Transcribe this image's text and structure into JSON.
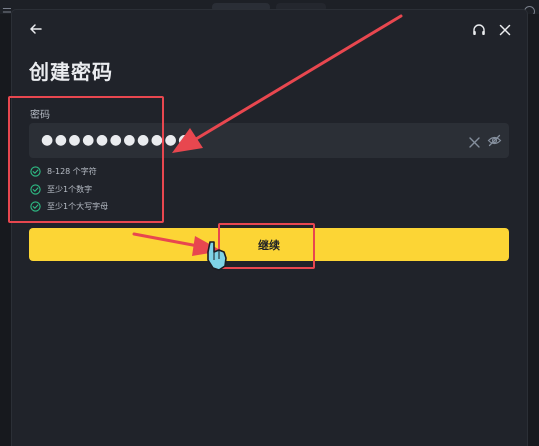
{
  "modal": {
    "title": "创建密码",
    "password_label": "密码",
    "password_value": "●●●●●●●●●●●",
    "rules": [
      {
        "text": "8-128 个字符"
      },
      {
        "text": "至少1个数字"
      },
      {
        "text": "至少1个大写字母"
      }
    ],
    "continue_label": "继续"
  },
  "background": {
    "menu_glyph": "☰"
  },
  "icons": {
    "back": "arrow-left-icon",
    "support": "headset-icon",
    "close": "close-icon",
    "clear": "clear-x-icon",
    "visibility": "eye-off-icon",
    "rule_ok": "check-circle-icon",
    "cursor": "hand-pointer-icon"
  },
  "colors": {
    "accent_yellow": "#fcd535",
    "success_green": "#2ebd85",
    "annotation_red": "#e8474f",
    "modal_bg": "#20232a",
    "input_bg": "#2b2f36"
  }
}
